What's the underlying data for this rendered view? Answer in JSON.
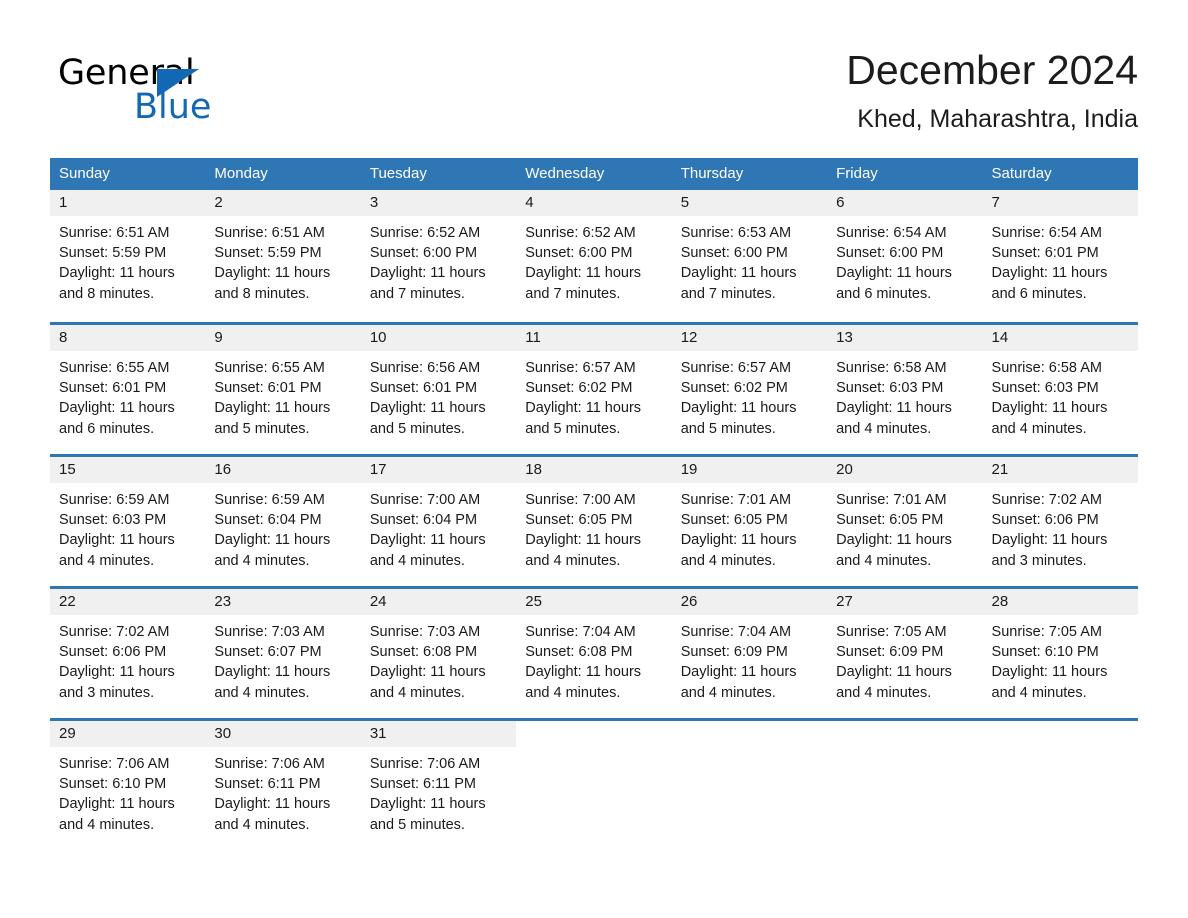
{
  "brand": {
    "name_part1": "General",
    "name_part2": "Blue",
    "triangle_icon": "blue-triangle-logo-mark",
    "accent_color": "#1268b3"
  },
  "header": {
    "title": "December 2024",
    "location": "Khed, Maharashtra, India"
  },
  "calendar": {
    "header_bg_color": "#2f76b5",
    "daynum_band_color": "#f0f0f0",
    "weekdays": [
      "Sunday",
      "Monday",
      "Tuesday",
      "Wednesday",
      "Thursday",
      "Friday",
      "Saturday"
    ],
    "weeks": [
      [
        {
          "day": "1",
          "lines": [
            "Sunrise: 6:51 AM",
            "Sunset: 5:59 PM",
            "Daylight: 11 hours",
            "and 8 minutes."
          ]
        },
        {
          "day": "2",
          "lines": [
            "Sunrise: 6:51 AM",
            "Sunset: 5:59 PM",
            "Daylight: 11 hours",
            "and 8 minutes."
          ]
        },
        {
          "day": "3",
          "lines": [
            "Sunrise: 6:52 AM",
            "Sunset: 6:00 PM",
            "Daylight: 11 hours",
            "and 7 minutes."
          ]
        },
        {
          "day": "4",
          "lines": [
            "Sunrise: 6:52 AM",
            "Sunset: 6:00 PM",
            "Daylight: 11 hours",
            "and 7 minutes."
          ]
        },
        {
          "day": "5",
          "lines": [
            "Sunrise: 6:53 AM",
            "Sunset: 6:00 PM",
            "Daylight: 11 hours",
            "and 7 minutes."
          ]
        },
        {
          "day": "6",
          "lines": [
            "Sunrise: 6:54 AM",
            "Sunset: 6:00 PM",
            "Daylight: 11 hours",
            "and 6 minutes."
          ]
        },
        {
          "day": "7",
          "lines": [
            "Sunrise: 6:54 AM",
            "Sunset: 6:01 PM",
            "Daylight: 11 hours",
            "and 6 minutes."
          ]
        }
      ],
      [
        {
          "day": "8",
          "lines": [
            "Sunrise: 6:55 AM",
            "Sunset: 6:01 PM",
            "Daylight: 11 hours",
            "and 6 minutes."
          ]
        },
        {
          "day": "9",
          "lines": [
            "Sunrise: 6:55 AM",
            "Sunset: 6:01 PM",
            "Daylight: 11 hours",
            "and 5 minutes."
          ]
        },
        {
          "day": "10",
          "lines": [
            "Sunrise: 6:56 AM",
            "Sunset: 6:01 PM",
            "Daylight: 11 hours",
            "and 5 minutes."
          ]
        },
        {
          "day": "11",
          "lines": [
            "Sunrise: 6:57 AM",
            "Sunset: 6:02 PM",
            "Daylight: 11 hours",
            "and 5 minutes."
          ]
        },
        {
          "day": "12",
          "lines": [
            "Sunrise: 6:57 AM",
            "Sunset: 6:02 PM",
            "Daylight: 11 hours",
            "and 5 minutes."
          ]
        },
        {
          "day": "13",
          "lines": [
            "Sunrise: 6:58 AM",
            "Sunset: 6:03 PM",
            "Daylight: 11 hours",
            "and 4 minutes."
          ]
        },
        {
          "day": "14",
          "lines": [
            "Sunrise: 6:58 AM",
            "Sunset: 6:03 PM",
            "Daylight: 11 hours",
            "and 4 minutes."
          ]
        }
      ],
      [
        {
          "day": "15",
          "lines": [
            "Sunrise: 6:59 AM",
            "Sunset: 6:03 PM",
            "Daylight: 11 hours",
            "and 4 minutes."
          ]
        },
        {
          "day": "16",
          "lines": [
            "Sunrise: 6:59 AM",
            "Sunset: 6:04 PM",
            "Daylight: 11 hours",
            "and 4 minutes."
          ]
        },
        {
          "day": "17",
          "lines": [
            "Sunrise: 7:00 AM",
            "Sunset: 6:04 PM",
            "Daylight: 11 hours",
            "and 4 minutes."
          ]
        },
        {
          "day": "18",
          "lines": [
            "Sunrise: 7:00 AM",
            "Sunset: 6:05 PM",
            "Daylight: 11 hours",
            "and 4 minutes."
          ]
        },
        {
          "day": "19",
          "lines": [
            "Sunrise: 7:01 AM",
            "Sunset: 6:05 PM",
            "Daylight: 11 hours",
            "and 4 minutes."
          ]
        },
        {
          "day": "20",
          "lines": [
            "Sunrise: 7:01 AM",
            "Sunset: 6:05 PM",
            "Daylight: 11 hours",
            "and 4 minutes."
          ]
        },
        {
          "day": "21",
          "lines": [
            "Sunrise: 7:02 AM",
            "Sunset: 6:06 PM",
            "Daylight: 11 hours",
            "and 3 minutes."
          ]
        }
      ],
      [
        {
          "day": "22",
          "lines": [
            "Sunrise: 7:02 AM",
            "Sunset: 6:06 PM",
            "Daylight: 11 hours",
            "and 3 minutes."
          ]
        },
        {
          "day": "23",
          "lines": [
            "Sunrise: 7:03 AM",
            "Sunset: 6:07 PM",
            "Daylight: 11 hours",
            "and 4 minutes."
          ]
        },
        {
          "day": "24",
          "lines": [
            "Sunrise: 7:03 AM",
            "Sunset: 6:08 PM",
            "Daylight: 11 hours",
            "and 4 minutes."
          ]
        },
        {
          "day": "25",
          "lines": [
            "Sunrise: 7:04 AM",
            "Sunset: 6:08 PM",
            "Daylight: 11 hours",
            "and 4 minutes."
          ]
        },
        {
          "day": "26",
          "lines": [
            "Sunrise: 7:04 AM",
            "Sunset: 6:09 PM",
            "Daylight: 11 hours",
            "and 4 minutes."
          ]
        },
        {
          "day": "27",
          "lines": [
            "Sunrise: 7:05 AM",
            "Sunset: 6:09 PM",
            "Daylight: 11 hours",
            "and 4 minutes."
          ]
        },
        {
          "day": "28",
          "lines": [
            "Sunrise: 7:05 AM",
            "Sunset: 6:10 PM",
            "Daylight: 11 hours",
            "and 4 minutes."
          ]
        }
      ],
      [
        {
          "day": "29",
          "lines": [
            "Sunrise: 7:06 AM",
            "Sunset: 6:10 PM",
            "Daylight: 11 hours",
            "and 4 minutes."
          ]
        },
        {
          "day": "30",
          "lines": [
            "Sunrise: 7:06 AM",
            "Sunset: 6:11 PM",
            "Daylight: 11 hours",
            "and 4 minutes."
          ]
        },
        {
          "day": "31",
          "lines": [
            "Sunrise: 7:06 AM",
            "Sunset: 6:11 PM",
            "Daylight: 11 hours",
            "and 5 minutes."
          ]
        },
        {
          "day": "",
          "lines": []
        },
        {
          "day": "",
          "lines": []
        },
        {
          "day": "",
          "lines": []
        },
        {
          "day": "",
          "lines": []
        }
      ]
    ]
  }
}
